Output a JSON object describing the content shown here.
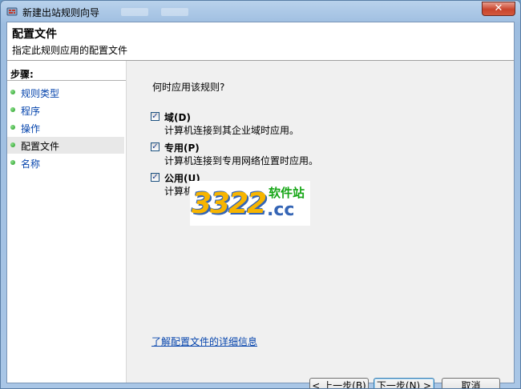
{
  "window": {
    "title": "新建出站规则向导",
    "close_glyph": "✕"
  },
  "header": {
    "title": "配置文件",
    "description": "指定此规则应用的配置文件"
  },
  "steps": {
    "header": "步骤:",
    "items": [
      {
        "label": "规则类型",
        "current": false
      },
      {
        "label": "程序",
        "current": false
      },
      {
        "label": "操作",
        "current": false
      },
      {
        "label": "配置文件",
        "current": true
      },
      {
        "label": "名称",
        "current": false
      }
    ]
  },
  "content": {
    "question": "何时应用该规则?",
    "options": [
      {
        "label": "域(D)",
        "description": "计算机连接到其企业域时应用。",
        "checked": true
      },
      {
        "label": "专用(P)",
        "description": "计算机连接到专用网络位置时应用。",
        "checked": true
      },
      {
        "label": "公用(U)",
        "description": "计算机",
        "checked": true
      }
    ],
    "link": "了解配置文件的详细信息"
  },
  "buttons": {
    "back": "< 上一步(B)",
    "next": "下一步(N) >",
    "cancel": "取消"
  },
  "watermark": {
    "digits": "3322",
    "site": "软件站",
    "domain": ".cc"
  },
  "icons": {
    "checkmark": "✓"
  },
  "colors": {
    "link": "#0645ad",
    "step_dot": "#1e9a1e",
    "close_button": "#c9442c"
  }
}
